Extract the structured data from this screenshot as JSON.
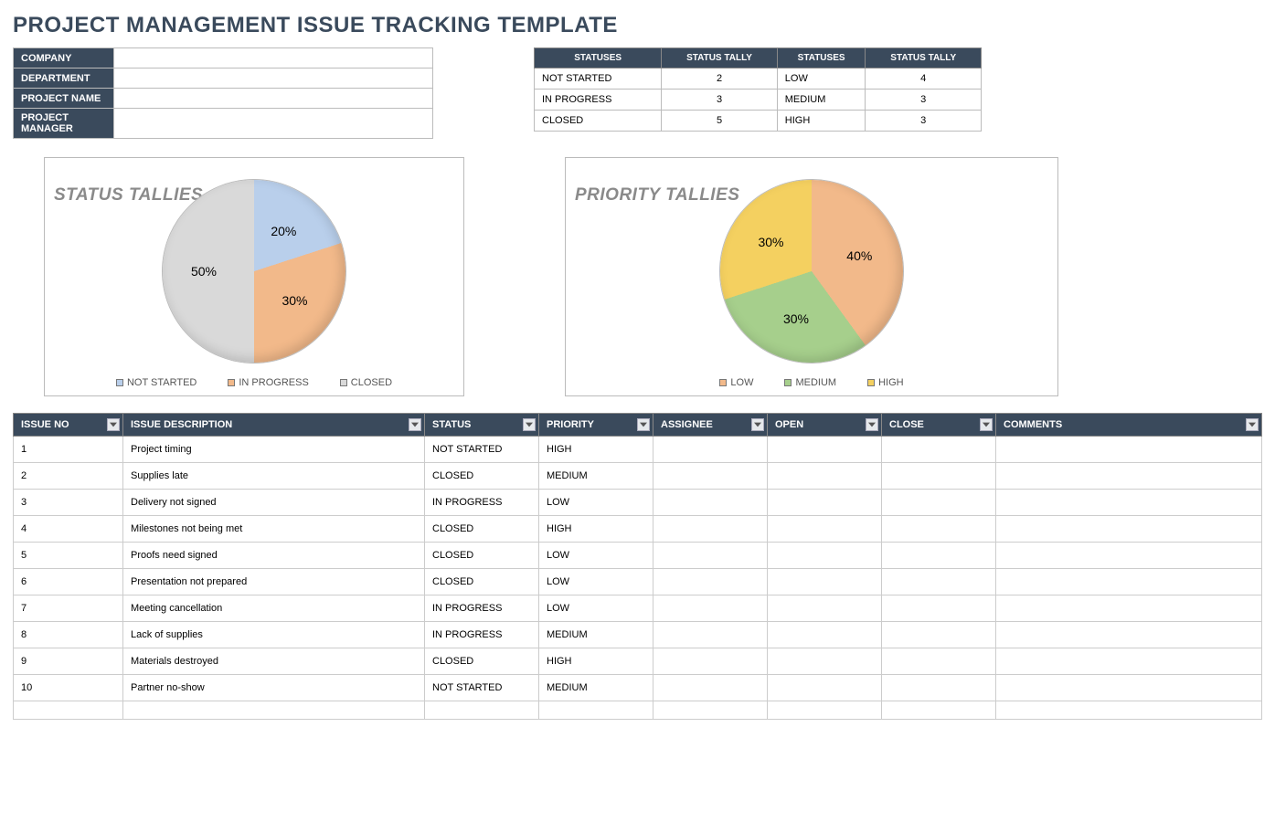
{
  "title": "PROJECT MANAGEMENT ISSUE TRACKING TEMPLATE",
  "meta": {
    "fields": [
      {
        "label": "COMPANY",
        "value": ""
      },
      {
        "label": "DEPARTMENT",
        "value": ""
      },
      {
        "label": "PROJECT NAME",
        "value": ""
      },
      {
        "label": "PROJECT MANAGER",
        "value": ""
      }
    ]
  },
  "tally": {
    "headers": [
      "STATUSES",
      "STATUS TALLY",
      "STATUSES",
      "STATUS TALLY"
    ],
    "rows": [
      {
        "s1": "NOT STARTED",
        "t1": "2",
        "s2": "LOW",
        "t2": "4"
      },
      {
        "s1": "IN PROGRESS",
        "t1": "3",
        "s2": "MEDIUM",
        "t2": "3"
      },
      {
        "s1": "CLOSED",
        "t1": "5",
        "s2": "HIGH",
        "t2": "3"
      }
    ]
  },
  "chart_data": [
    {
      "type": "pie",
      "title": "STATUS TALLIES",
      "categories": [
        "NOT STARTED",
        "IN PROGRESS",
        "CLOSED"
      ],
      "values": [
        20,
        30,
        50
      ],
      "colors": [
        "#b9cfeb",
        "#f2b98a",
        "#d9d9d9"
      ],
      "labels": [
        "20%",
        "30%",
        "50%"
      ]
    },
    {
      "type": "pie",
      "title": "PRIORITY TALLIES",
      "categories": [
        "LOW",
        "MEDIUM",
        "HIGH"
      ],
      "values": [
        40,
        30,
        30
      ],
      "colors": [
        "#f2b98a",
        "#a6cf8c",
        "#f4d060"
      ],
      "labels": [
        "40%",
        "30%",
        "30%"
      ]
    }
  ],
  "issues": {
    "headers": [
      "ISSUE NO",
      "ISSUE DESCRIPTION",
      "STATUS",
      "PRIORITY",
      "ASSIGNEE",
      "OPEN",
      "CLOSE",
      "COMMENTS"
    ],
    "rows": [
      {
        "no": "1",
        "desc": "Project timing",
        "status": "NOT STARTED",
        "priority": "HIGH",
        "assignee": "",
        "open": "",
        "close": "",
        "comments": ""
      },
      {
        "no": "2",
        "desc": "Supplies late",
        "status": "CLOSED",
        "priority": "MEDIUM",
        "assignee": "",
        "open": "",
        "close": "",
        "comments": ""
      },
      {
        "no": "3",
        "desc": "Delivery not signed",
        "status": "IN PROGRESS",
        "priority": "LOW",
        "assignee": "",
        "open": "",
        "close": "",
        "comments": ""
      },
      {
        "no": "4",
        "desc": "Milestones not being met",
        "status": "CLOSED",
        "priority": "HIGH",
        "assignee": "",
        "open": "",
        "close": "",
        "comments": ""
      },
      {
        "no": "5",
        "desc": "Proofs need signed",
        "status": "CLOSED",
        "priority": "LOW",
        "assignee": "",
        "open": "",
        "close": "",
        "comments": ""
      },
      {
        "no": "6",
        "desc": "Presentation not prepared",
        "status": "CLOSED",
        "priority": "LOW",
        "assignee": "",
        "open": "",
        "close": "",
        "comments": ""
      },
      {
        "no": "7",
        "desc": "Meeting cancellation",
        "status": "IN PROGRESS",
        "priority": "LOW",
        "assignee": "",
        "open": "",
        "close": "",
        "comments": ""
      },
      {
        "no": "8",
        "desc": "Lack of supplies",
        "status": "IN PROGRESS",
        "priority": "MEDIUM",
        "assignee": "",
        "open": "",
        "close": "",
        "comments": ""
      },
      {
        "no": "9",
        "desc": "Materials destroyed",
        "status": "CLOSED",
        "priority": "HIGH",
        "assignee": "",
        "open": "",
        "close": "",
        "comments": ""
      },
      {
        "no": "10",
        "desc": "Partner no-show",
        "status": "NOT STARTED",
        "priority": "MEDIUM",
        "assignee": "",
        "open": "",
        "close": "",
        "comments": ""
      },
      {
        "no": "",
        "desc": "",
        "status": "",
        "priority": "",
        "assignee": "",
        "open": "",
        "close": "",
        "comments": ""
      }
    ]
  }
}
